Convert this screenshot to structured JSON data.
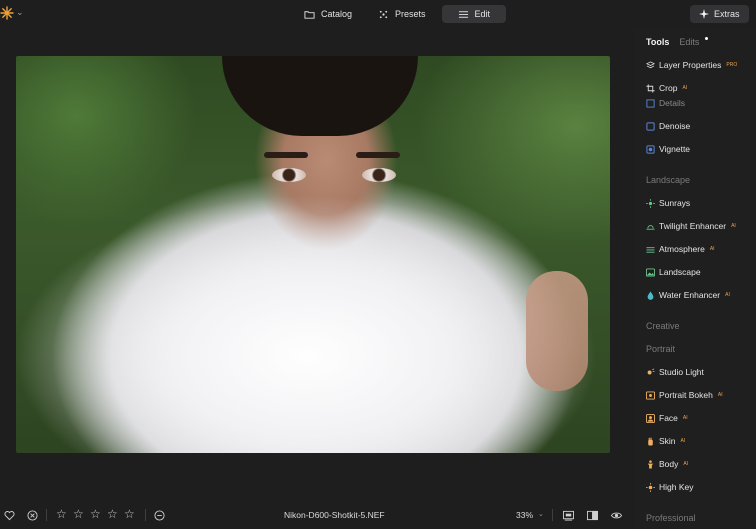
{
  "topbar": {
    "nav": [
      {
        "label": "Catalog",
        "icon": "folder-icon"
      },
      {
        "label": "Presets",
        "icon": "presets-icon"
      },
      {
        "label": "Edit",
        "icon": "sliders-icon",
        "active": true
      }
    ],
    "extras_label": "Extras"
  },
  "panel": {
    "tabs": [
      {
        "label": "Tools",
        "active": true
      },
      {
        "label": "Edits",
        "active": false,
        "has_dot": true
      }
    ],
    "items": {
      "layer_properties": {
        "label": "Layer Properties",
        "badge": "PRO"
      },
      "crop": {
        "label": "Crop",
        "badge": "AI"
      },
      "details": {
        "label": "Details"
      },
      "denoise": {
        "label": "Denoise"
      },
      "vignette": {
        "label": "Vignette"
      },
      "sunrays": {
        "label": "Sunrays"
      },
      "twilight": {
        "label": "Twilight Enhancer",
        "badge": "AI"
      },
      "atmosphere": {
        "label": "Atmosphere",
        "badge": "AI"
      },
      "landscape": {
        "label": "Landscape"
      },
      "water": {
        "label": "Water Enhancer",
        "badge": "AI"
      },
      "studio_light": {
        "label": "Studio Light"
      },
      "portrait_bokeh": {
        "label": "Portrait Bokeh",
        "badge": "AI"
      },
      "face": {
        "label": "Face",
        "badge": "AI"
      },
      "skin": {
        "label": "Skin",
        "badge": "AI"
      },
      "body": {
        "label": "Body",
        "badge": "AI"
      },
      "high_key": {
        "label": "High Key"
      }
    },
    "sections": {
      "landscape": "Landscape",
      "creative": "Creative",
      "portrait": "Portrait",
      "professional": "Professional"
    }
  },
  "bottombar": {
    "filename": "Nikon-D600-Shotkit-5.NEF",
    "zoom": "33%",
    "rating": 0,
    "max_rating": 5
  },
  "colors": {
    "accent": "#e9a14c",
    "background": "#1e1e1f",
    "panel": "#1f1f20"
  }
}
